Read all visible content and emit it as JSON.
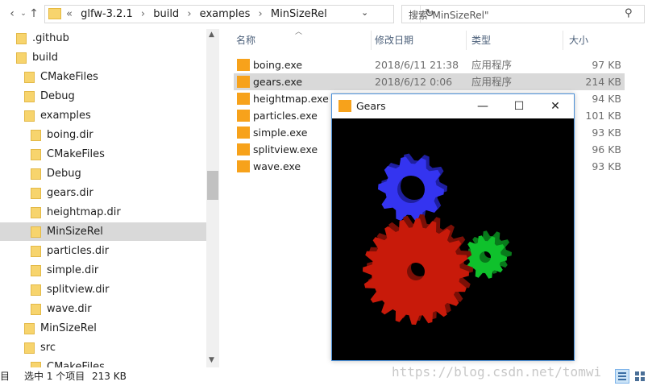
{
  "addressbar": {
    "back_icon": "arrow-up-icon",
    "crumbs": [
      "«",
      "glfw-3.2.1",
      "›",
      "build",
      "›",
      "examples",
      "›",
      "MinSizeRel"
    ],
    "search_placeholder": "搜索\"MinSizeRel\""
  },
  "nav": {
    "items": [
      {
        "label": ".github",
        "level": 1
      },
      {
        "label": "build",
        "level": 1
      },
      {
        "label": "CMakeFiles",
        "level": 2
      },
      {
        "label": "Debug",
        "level": 2
      },
      {
        "label": "examples",
        "level": 2
      },
      {
        "label": "boing.dir",
        "level": 3
      },
      {
        "label": "CMakeFiles",
        "level": 3
      },
      {
        "label": "Debug",
        "level": 3
      },
      {
        "label": "gears.dir",
        "level": 3
      },
      {
        "label": "heightmap.dir",
        "level": 3
      },
      {
        "label": "MinSizeRel",
        "level": 3,
        "selected": true
      },
      {
        "label": "particles.dir",
        "level": 3
      },
      {
        "label": "simple.dir",
        "level": 3
      },
      {
        "label": "splitview.dir",
        "level": 3
      },
      {
        "label": "wave.dir",
        "level": 3
      },
      {
        "label": "MinSizeRel",
        "level": 2
      },
      {
        "label": "src",
        "level": 2
      },
      {
        "label": "CMakeFiles",
        "level": 3
      }
    ]
  },
  "columns": {
    "name": "名称",
    "date": "修改日期",
    "type": "类型",
    "size": "大小"
  },
  "files": [
    {
      "name": "boing.exe",
      "date": "2018/6/11 21:38",
      "type": "应用程序",
      "size": "97 KB"
    },
    {
      "name": "gears.exe",
      "date": "2018/6/12 0:06",
      "type": "应用程序",
      "size": "214 KB",
      "selected": true
    },
    {
      "name": "heightmap.exe",
      "date": "",
      "type": "",
      "size": "94 KB"
    },
    {
      "name": "particles.exe",
      "date": "",
      "type": "",
      "size": "101 KB"
    },
    {
      "name": "simple.exe",
      "date": "",
      "type": "",
      "size": "93 KB"
    },
    {
      "name": "splitview.exe",
      "date": "",
      "type": "",
      "size": "96 KB"
    },
    {
      "name": "wave.exe",
      "date": "",
      "type": "",
      "size": "93 KB"
    }
  ],
  "status": {
    "count_fragment": "目",
    "selection": "选中 1 个项目",
    "selection_size": "213 KB",
    "watermark": "https://blog.csdn.net/tomwi"
  },
  "gears_window": {
    "title": "Gears",
    "minimize": "—",
    "maximize": "☐",
    "close": "✕",
    "colors": {
      "red": "#c81a0a",
      "green": "#0fc12c",
      "blue": "#3434f0"
    }
  }
}
